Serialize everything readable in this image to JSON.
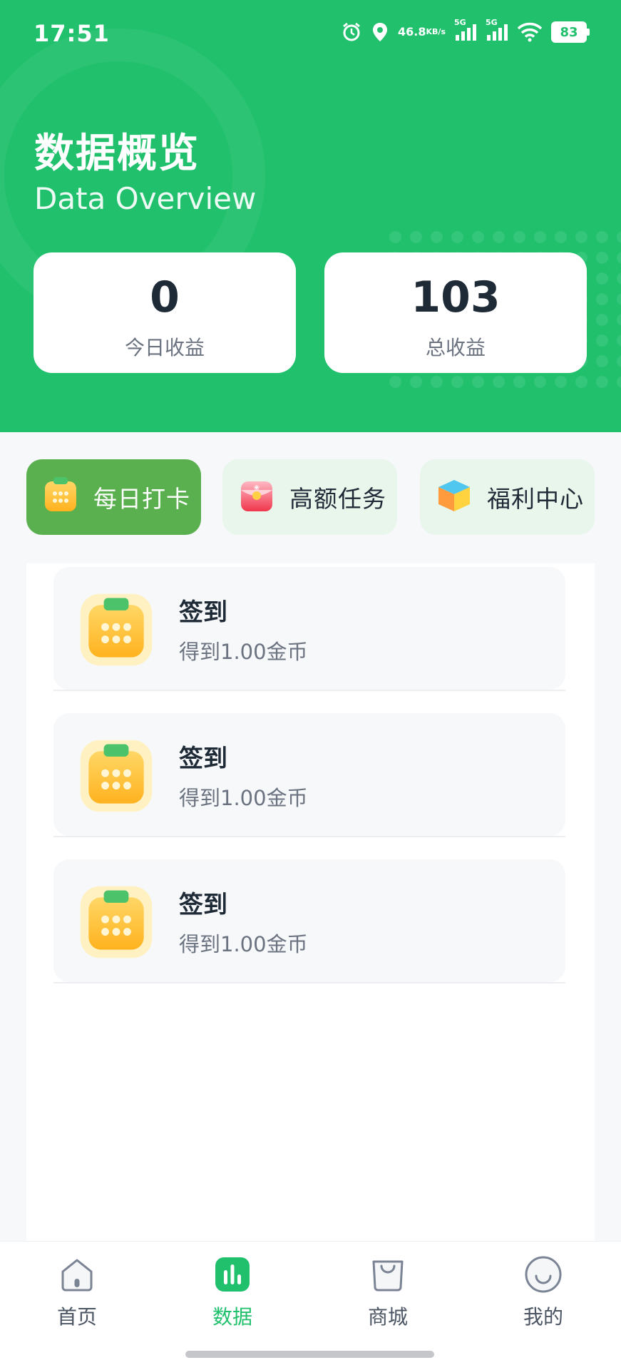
{
  "status_bar": {
    "time": "17:51",
    "network_speed": "46.8",
    "network_unit": "KB/s",
    "signal_1": "5G",
    "signal_2": "5G",
    "battery": "83"
  },
  "header": {
    "title": "数据概览",
    "subtitle": "Data Overview",
    "accent_color": "#20c06d"
  },
  "stats": [
    {
      "value": "0",
      "label": "今日收益"
    },
    {
      "value": "103",
      "label": "总收益"
    }
  ],
  "tabs": [
    {
      "label": "每日打卡",
      "icon": "calendar-icon",
      "active": true
    },
    {
      "label": "高额任务",
      "icon": "red-envelope-icon",
      "active": false
    },
    {
      "label": "福利中心",
      "icon": "cube-icon",
      "active": false
    }
  ],
  "items": [
    {
      "title": "签到",
      "desc": "得到1.00金币",
      "icon": "calendar-icon"
    },
    {
      "title": "签到",
      "desc": "得到1.00金币",
      "icon": "calendar-icon"
    },
    {
      "title": "签到",
      "desc": "得到1.00金币",
      "icon": "calendar-icon"
    }
  ],
  "nav": [
    {
      "label": "首页",
      "icon": "home-icon",
      "active": false
    },
    {
      "label": "数据",
      "icon": "bar-chart-icon",
      "active": true
    },
    {
      "label": "商城",
      "icon": "shopping-bag-icon",
      "active": false
    },
    {
      "label": "我的",
      "icon": "smile-icon",
      "active": false
    }
  ]
}
